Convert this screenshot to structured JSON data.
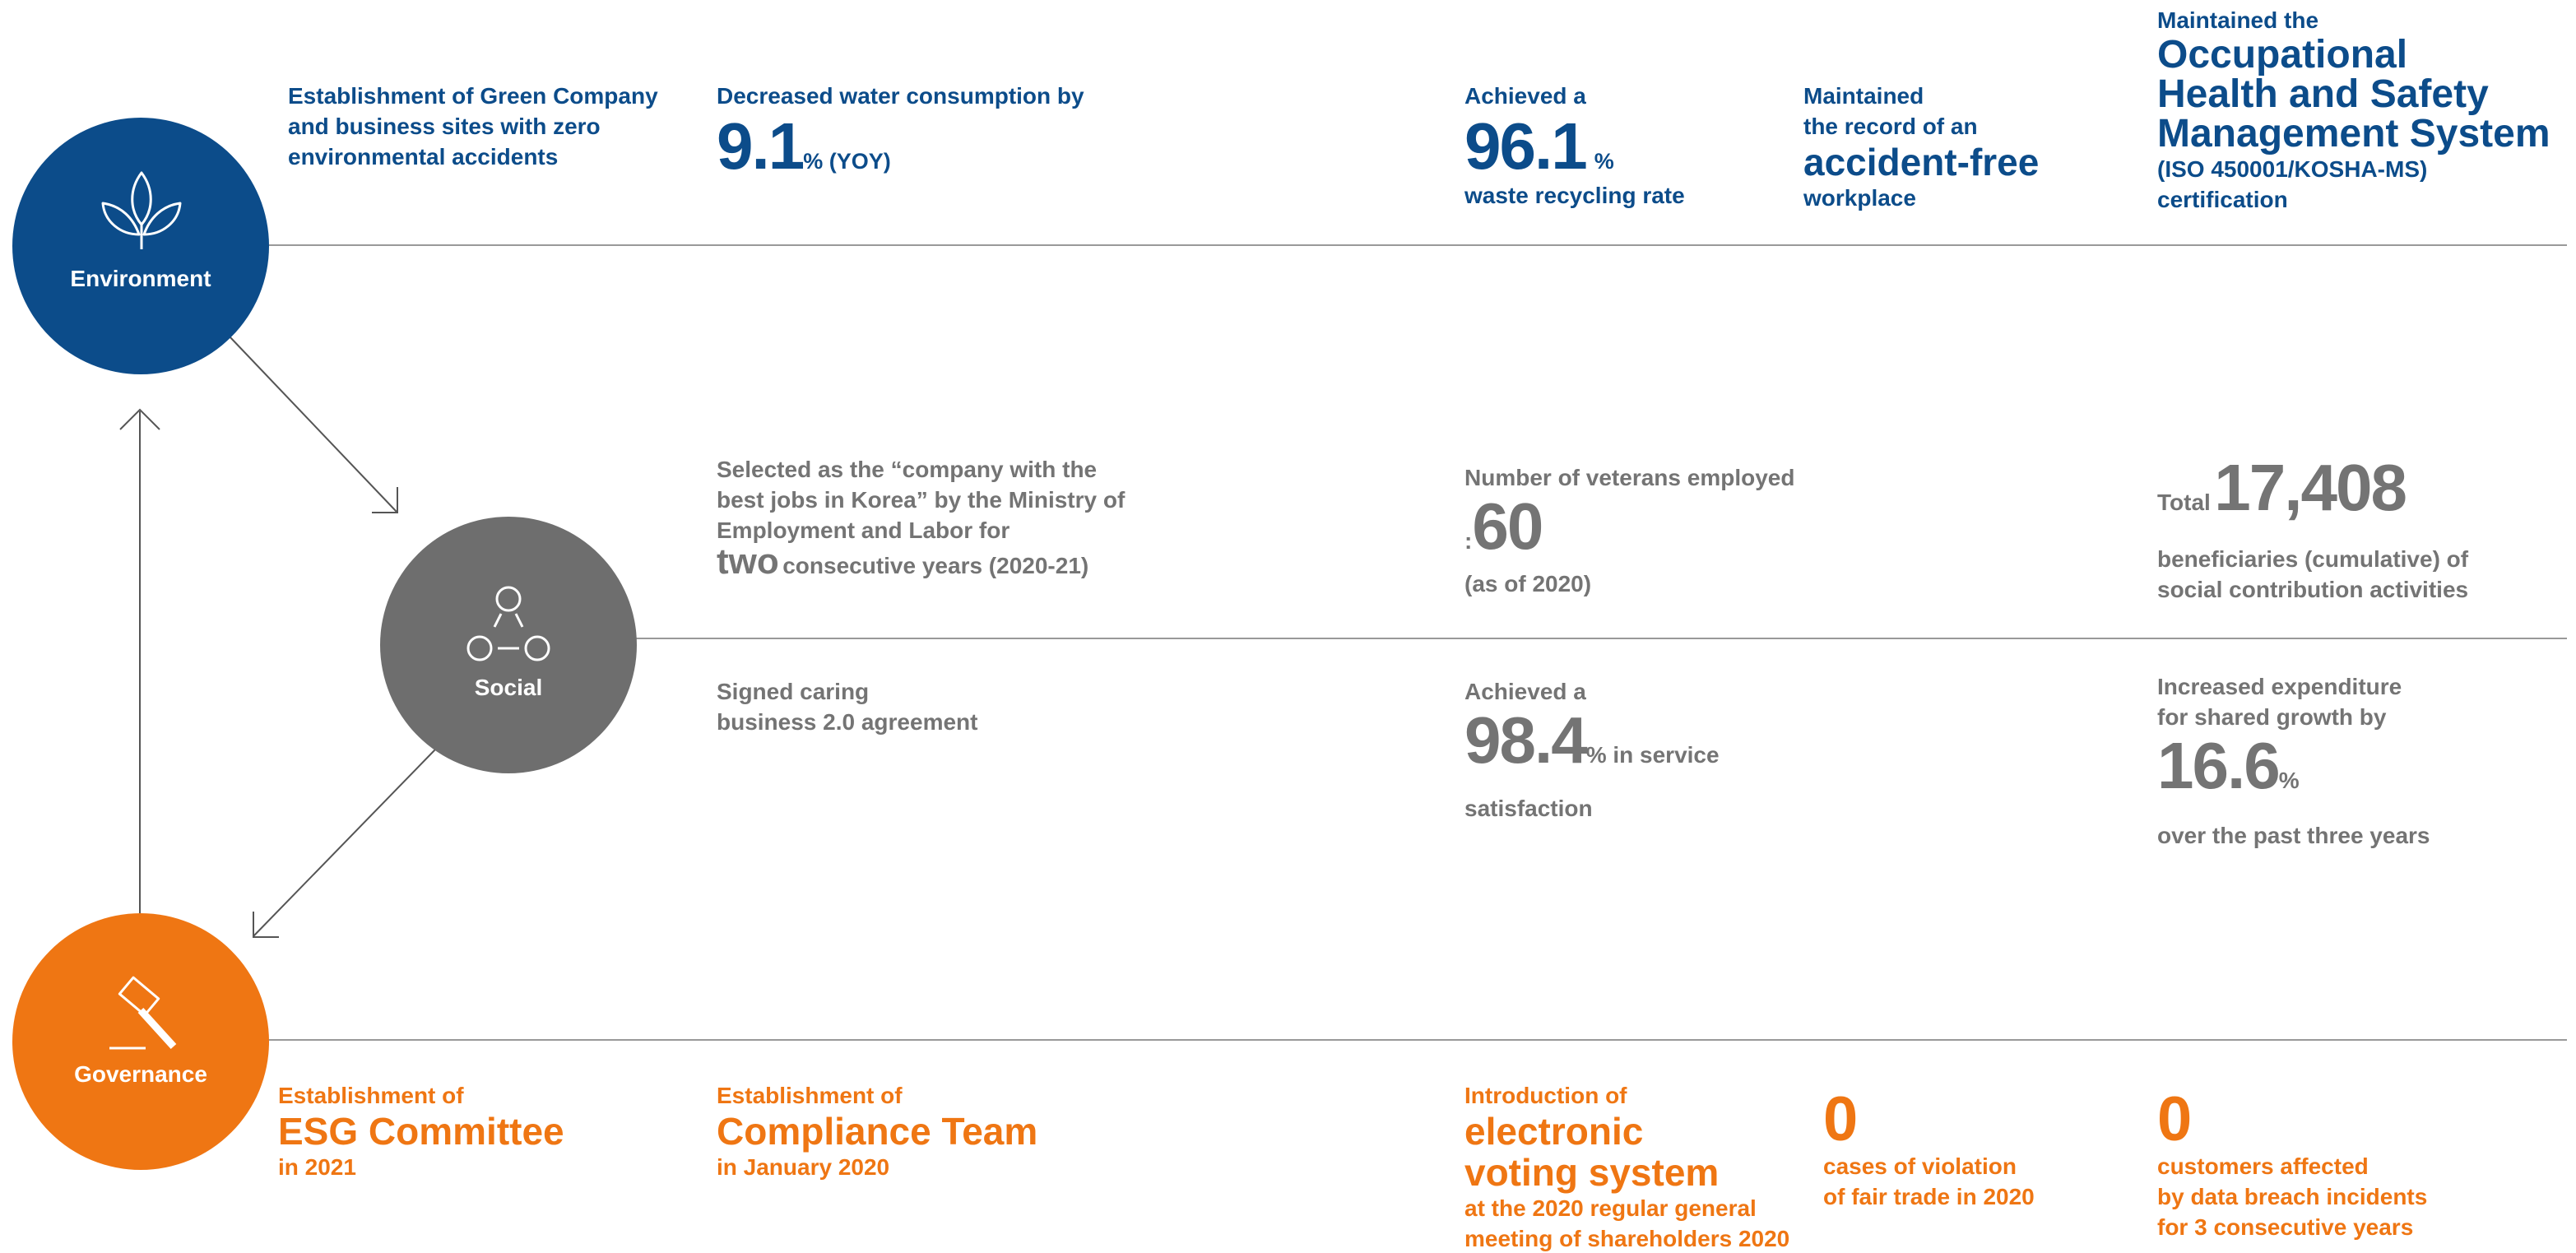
{
  "colors": {
    "environment": "#0c4c8a",
    "social": "#6e6e6e",
    "governance": "#ef7613",
    "line": "#999999"
  },
  "environment": {
    "label": "Environment",
    "icon": "leaves-icon",
    "item1": {
      "line1": "Establishment of Green Company",
      "line2": "and business sites with zero",
      "line3": "environmental accidents"
    },
    "item2": {
      "lead": "Decreased water consumption by",
      "value": "9.1",
      "unit": "% (YOY)"
    },
    "item3": {
      "lead": "Achieved a",
      "value": "96.1",
      "unit": "%",
      "tail": "waste recycling rate"
    },
    "item4": {
      "line1": "Maintained",
      "line2": "the record of an",
      "big": "accident-free",
      "line3": "workplace"
    },
    "item5": {
      "lead": "Maintained the",
      "big1": "Occupational",
      "big2": "Health and Safety",
      "big3": "Management System",
      "line1": "(ISO 450001/KOSHA-MS)",
      "line2": "certification"
    }
  },
  "social": {
    "label": "Social",
    "icon": "network-nodes-icon",
    "item1": {
      "line1": "Selected as the “company with the",
      "line2": "best jobs in Korea” by the Ministry of",
      "line3": "Employment and Labor for",
      "big": "two",
      "line4": "consecutive years (2020-21)"
    },
    "item2": {
      "lead": "Number of veterans employed",
      "prefix": ":",
      "value": "60",
      "tail": "(as of 2020)"
    },
    "item3": {
      "lead": "Total",
      "value": "17,408",
      "line1": "beneficiaries (cumulative) of",
      "line2": "social contribution activities"
    },
    "item4": {
      "line1": "Signed caring",
      "line2": "business 2.0 agreement"
    },
    "item5": {
      "lead": "Achieved a",
      "value": "98.4",
      "unit": "% in service",
      "tail": "satisfaction"
    },
    "item6": {
      "line1": "Increased expenditure",
      "line2": "for shared growth by",
      "value": "16.6",
      "unit": "%",
      "tail": "over the past three years"
    }
  },
  "governance": {
    "label": "Governance",
    "icon": "gavel-icon",
    "item1": {
      "lead": "Establishment of",
      "big": "ESG Committee",
      "tail": "in 2021"
    },
    "item2": {
      "lead": "Establishment of",
      "big": "Compliance Team",
      "tail": "in January 2020"
    },
    "item3": {
      "lead": "Introduction of",
      "big1": "electronic",
      "big2": "voting system",
      "line1": "at the 2020 regular general",
      "line2": "meeting of shareholders 2020"
    },
    "item4": {
      "value": "0",
      "line1": "cases of violation",
      "line2": "of fair trade in 2020"
    },
    "item5": {
      "value": "0",
      "line1": "customers affected",
      "line2": "by data breach incidents",
      "line3": "for 3 consecutive years"
    }
  }
}
